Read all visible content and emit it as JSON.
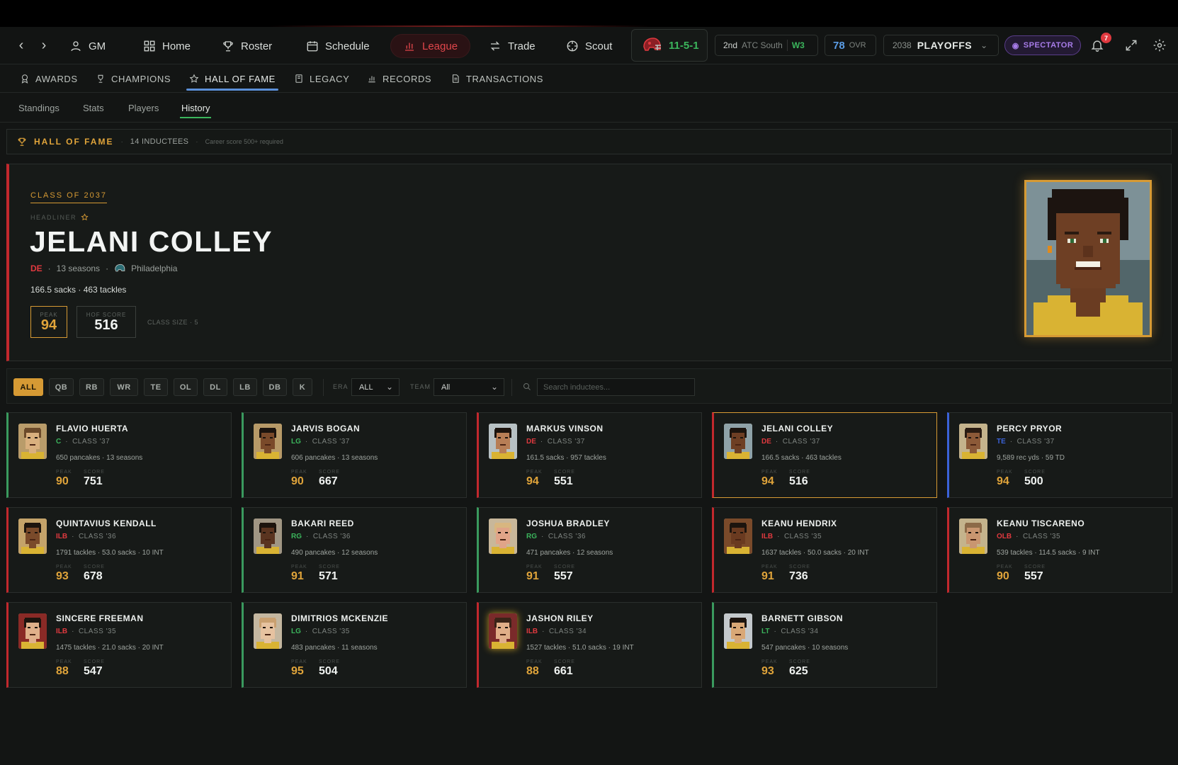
{
  "nav": {
    "gm_label": "GM",
    "items": [
      {
        "label": "Home"
      },
      {
        "label": "Roster"
      },
      {
        "label": "Schedule"
      },
      {
        "label": "League"
      },
      {
        "label": "Trade"
      },
      {
        "label": "Scout"
      }
    ],
    "record": "11-5-1",
    "standing_rank": "2nd",
    "standing_division": "ATC South",
    "standing_week": "W3",
    "ovr_value": "78",
    "ovr_label": "OVR",
    "season_year": "2038",
    "season_phase": "PLAYOFFS",
    "spectator_label": "SPECTATOR",
    "notification_count": "7",
    "colors": {
      "accent_red": "#e0464b",
      "accent_gold": "#d69a34",
      "accent_green": "#3bb55c",
      "accent_blue": "#5b9de6",
      "accent_purple": "#a77ce8"
    }
  },
  "subnav": {
    "items": [
      {
        "label": "AWARDS"
      },
      {
        "label": "CHAMPIONS"
      },
      {
        "label": "HALL OF FAME"
      },
      {
        "label": "LEGACY"
      },
      {
        "label": "RECORDS"
      },
      {
        "label": "TRANSACTIONS"
      }
    ]
  },
  "tabs": [
    {
      "label": "Standings"
    },
    {
      "label": "Stats"
    },
    {
      "label": "Players"
    },
    {
      "label": "History"
    }
  ],
  "hof_bar": {
    "title": "HALL OF FAME",
    "count": "14 INDUCTEES",
    "requirement": "Career score 500+ required"
  },
  "hero": {
    "class_label": "CLASS OF 2037",
    "headliner": "HEADLINER",
    "name": "JELANI COLLEY",
    "position": "DE",
    "seasons": "13 seasons",
    "team": "Philadelphia",
    "stats": "166.5 sacks · 463 tackles",
    "peak_label": "PEAK",
    "peak": "94",
    "score_label": "HOF SCORE",
    "score": "516",
    "class_size_label": "CLASS SIZE",
    "class_size": "5"
  },
  "filters": {
    "positions": [
      "ALL",
      "QB",
      "RB",
      "WR",
      "TE",
      "OL",
      "DL",
      "LB",
      "DB",
      "K"
    ],
    "era_label": "ERA",
    "era_value": "ALL",
    "team_label": "TEAM",
    "team_value": "All",
    "search_placeholder": "Search inductees..."
  },
  "card_labels": {
    "peak": "PEAK",
    "score": "SCORE"
  },
  "cards": [
    {
      "name": "FLAVIO HUERTA",
      "pos": "C",
      "cls": "CLASS '37",
      "stats": "650 pancakes · 13 seasons",
      "peak": "90",
      "score": "751"
    },
    {
      "name": "JARVIS BOGAN",
      "pos": "LG",
      "cls": "CLASS '37",
      "stats": "606 pancakes · 13 seasons",
      "peak": "90",
      "score": "667"
    },
    {
      "name": "MARKUS VINSON",
      "pos": "DE",
      "cls": "CLASS '37",
      "stats": "161.5 sacks · 957 tackles",
      "peak": "94",
      "score": "551"
    },
    {
      "name": "JELANI COLLEY",
      "pos": "DE",
      "cls": "CLASS '37",
      "stats": "166.5 sacks · 463 tackles",
      "peak": "94",
      "score": "516"
    },
    {
      "name": "PERCY PRYOR",
      "pos": "TE",
      "cls": "CLASS '37",
      "stats": "9,589 rec yds · 59 TD",
      "peak": "94",
      "score": "500"
    },
    {
      "name": "QUINTAVIUS KENDALL",
      "pos": "ILB",
      "cls": "CLASS '36",
      "stats": "1791 tackles · 53.0 sacks · 10 INT",
      "peak": "93",
      "score": "678"
    },
    {
      "name": "BAKARI REED",
      "pos": "RG",
      "cls": "CLASS '36",
      "stats": "490 pancakes · 12 seasons",
      "peak": "91",
      "score": "571"
    },
    {
      "name": "JOSHUA BRADLEY",
      "pos": "RG",
      "cls": "CLASS '36",
      "stats": "471 pancakes · 12 seasons",
      "peak": "91",
      "score": "557"
    },
    {
      "name": "KEANU HENDRIX",
      "pos": "ILB",
      "cls": "CLASS '35",
      "stats": "1637 tackles · 50.0 sacks · 20 INT",
      "peak": "91",
      "score": "736"
    },
    {
      "name": "KEANU TISCARENO",
      "pos": "OLB",
      "cls": "CLASS '35",
      "stats": "539 tackles · 114.5 sacks · 9 INT",
      "peak": "90",
      "score": "557"
    },
    {
      "name": "SINCERE FREEMAN",
      "pos": "ILB",
      "cls": "CLASS '35",
      "stats": "1475 tackles · 21.0 sacks · 20 INT",
      "peak": "88",
      "score": "547"
    },
    {
      "name": "DIMITRIOS MCKENZIE",
      "pos": "LG",
      "cls": "CLASS '35",
      "stats": "483 pancakes · 11 seasons",
      "peak": "95",
      "score": "504"
    },
    {
      "name": "JASHON RILEY",
      "pos": "ILB",
      "cls": "CLASS '34",
      "stats": "1527 tackles · 51.0 sacks · 19 INT",
      "peak": "88",
      "score": "661"
    },
    {
      "name": "BARNETT GIBSON",
      "pos": "LT",
      "cls": "CLASS '34",
      "stats": "547 pancakes · 10 seasons",
      "peak": "93",
      "score": "625"
    }
  ]
}
